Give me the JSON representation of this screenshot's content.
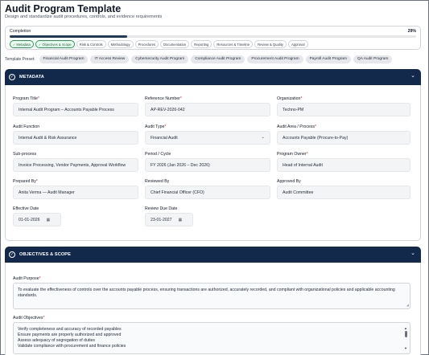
{
  "page": {
    "title": "Audit Program Template",
    "subtitle": "Design and standardize audit procedures, controls, and evidence requirements"
  },
  "progress": {
    "label": "Completion",
    "percent_text": "29%",
    "fraction": 0.29,
    "steps": [
      {
        "label": "Metadata",
        "done": true
      },
      {
        "label": "Objectives & Scope",
        "done": true
      },
      {
        "label": "Risk & Controls",
        "done": false
      },
      {
        "label": "Methodology",
        "done": false
      },
      {
        "label": "Procedures",
        "done": false
      },
      {
        "label": "Documentation",
        "done": false
      },
      {
        "label": "Reporting",
        "done": false
      },
      {
        "label": "Resources & Timeline",
        "done": false
      },
      {
        "label": "Review & Quality",
        "done": false
      },
      {
        "label": "Approval",
        "done": false
      }
    ]
  },
  "presets": {
    "label": "Template Preset:",
    "items": [
      "Financial Audit Program",
      "IT Access Review",
      "Cybersecurity Audit Program",
      "Compliance Audit Program",
      "Procurement Audit Program",
      "Payroll Audit Program",
      "QA Audit Program"
    ]
  },
  "metadata": {
    "title": "METADATA",
    "program_title": {
      "label": "Program Title",
      "value": "Internal Audit Program – Accounts Payable Process"
    },
    "reference_number": {
      "label": "Reference Number",
      "value": "AP-REV-2026-042"
    },
    "organization": {
      "label": "Organization",
      "value": "Techno-PM"
    },
    "audit_function": {
      "label": "Audit Function",
      "value": "Internal Audit & Risk Assurance"
    },
    "audit_type": {
      "label": "Audit Type",
      "value": "Financial Audit"
    },
    "audit_area": {
      "label": "Audit Area / Process",
      "value": "Accounts Payable (Procure-to-Pay)"
    },
    "sub_process": {
      "label": "Sub-process",
      "value": "Invoice Processing, Vendor Payments, Approval Workflow"
    },
    "period": {
      "label": "Period / Cycle",
      "value": "FY 2026 (Jan 2026 – Dec 2026)"
    },
    "program_owner": {
      "label": "Program Owner",
      "value": "Head of Internal Audit"
    },
    "prepared_by": {
      "label": "Prepared By",
      "value": "Anita Verma — Audit Manager"
    },
    "reviewed_by": {
      "label": "Reviewed By",
      "value": "Chief Financial Officer (CFO)"
    },
    "approved_by": {
      "label": "Approved By",
      "value": "Audit Committee"
    },
    "effective_date": {
      "label": "Effective Date",
      "value": "01-01-2026"
    },
    "review_due_date": {
      "label": "Review Due Date",
      "value": "23-01-2027"
    }
  },
  "objectives": {
    "title": "OBJECTIVES & SCOPE",
    "audit_purpose": {
      "label": "Audit Purpose",
      "line1": "To evaluate the effectiveness of controls over the accounts payable process, ensuring transactions are authorized, accurately recorded, and compliant with organizational policies and applicable accounting",
      "line2": "standards."
    },
    "audit_objectives": {
      "label": "Audit Objectives",
      "lines": [
        "Verify completeness and accuracy of recorded payables",
        "Ensure payments are properly authorized and approved",
        "Assess adequacy of segregation of duties",
        "Validate compliance with procurement and finance policies"
      ]
    }
  },
  "icons": {
    "check": "✓",
    "chevron": "⌄",
    "calendar": "▦",
    "required": "*"
  },
  "colors": {
    "header_bg": "#13294b",
    "progress_fill": "#1e3a5f",
    "done_step": "#16a34a",
    "required": "#dc2626"
  }
}
